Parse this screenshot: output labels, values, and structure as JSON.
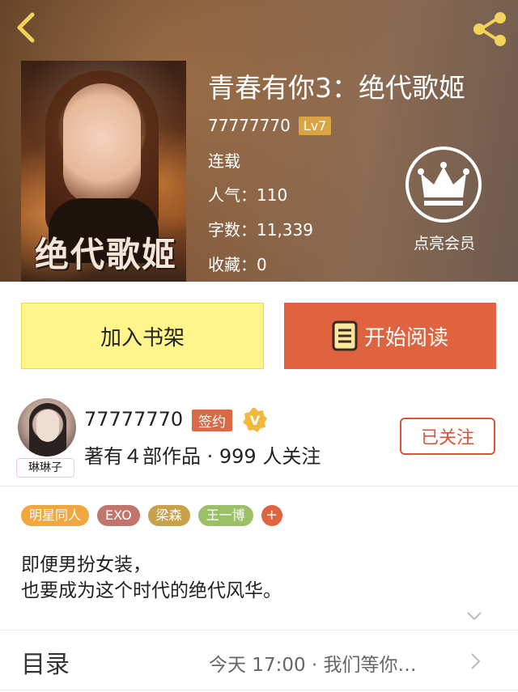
{
  "header": {
    "book_title": "青春有你3：绝代歌姬",
    "author": "77777770",
    "author_level": "Lv7",
    "status": "连载",
    "popularity": "人气：110",
    "word_count": "字数：11,339",
    "favorites": "收藏：0",
    "vip_label": "点亮会员",
    "cover_title": "绝代歌姬",
    "back_icon": "chevron-left-icon",
    "share_icon": "share-icon"
  },
  "actions": {
    "add_shelf_label": "加入书架",
    "start_read_label": "开始阅读"
  },
  "writer": {
    "name": "77777770",
    "sign_badge": "签约",
    "v_badge": "V",
    "stats": "著有４部作品 · 999 人关注",
    "avatar_tag": "琳琳子",
    "follow_label": "已关注"
  },
  "tags": [
    {
      "label": "明星同人",
      "color": "#f0a73f"
    },
    {
      "label": "EXO",
      "color": "#c0766c"
    },
    {
      "label": "梁森",
      "color": "#c8a24a"
    },
    {
      "label": "王一博",
      "color": "#9cc06a"
    }
  ],
  "tag_add_label": "+",
  "description": {
    "line1": "即便男扮女装，",
    "line2": "也要成为这个时代的绝代风华。"
  },
  "toc": {
    "label": "目录",
    "latest": "今天 17:00 · 我们等你…"
  },
  "colors": {
    "accent": "#e0633f",
    "shelf_button": "#fff58a",
    "level_badge": "#d9a441"
  }
}
